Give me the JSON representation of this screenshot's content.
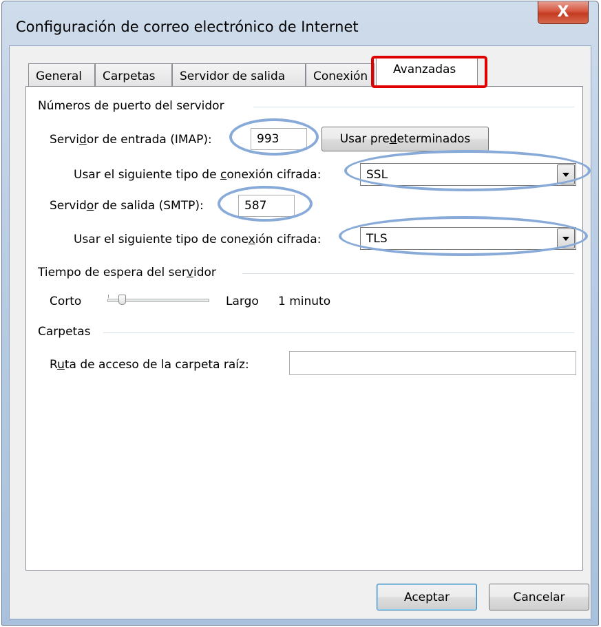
{
  "window": {
    "title": "Configuración de correo electrónico de Internet",
    "close_glyph": "X"
  },
  "tabs": [
    {
      "label": "General",
      "active": false
    },
    {
      "label": "Carpetas",
      "active": false
    },
    {
      "label": "Servidor de salida",
      "active": false
    },
    {
      "label": "Conexión",
      "active": false
    },
    {
      "label": "Avanzadas",
      "active": true
    }
  ],
  "ports": {
    "group_title": "Números de puerto del servidor",
    "incoming": {
      "label_pre": "Servi",
      "label_ul": "d",
      "label_post": "or de entrada (IMAP):",
      "value": "993"
    },
    "defaults_button": {
      "pre": "Usar pre",
      "ul": "d",
      "post": "eterminados"
    },
    "incoming_encryption": {
      "label_pre": "Usar el siguiente tipo de ",
      "label_ul": "c",
      "label_post": "onexión cifrada:",
      "value": "SSL"
    },
    "outgoing": {
      "label_pre": "Servid",
      "label_ul": "o",
      "label_post": "r de salida (SMTP):",
      "value": "587"
    },
    "outgoing_encryption": {
      "label_pre": "Usar el siguiente tipo de cone",
      "label_ul": "x",
      "label_post": "ión cifrada:",
      "value": "TLS"
    }
  },
  "timeout": {
    "group_title_pre": "Tiempo de espera del ser",
    "group_title_ul": "v",
    "group_title_post": "idor",
    "min_label": "Corto",
    "max_label": "Largo",
    "value_text": "1 minuto",
    "level": 0.12
  },
  "folders": {
    "group_title": "Carpetas",
    "root_label_pre": "R",
    "root_label_ul": "u",
    "root_label_post": "ta de acceso de la carpeta raíz:",
    "root_value": ""
  },
  "footer": {
    "ok_label": "Aceptar",
    "cancel_label": "Cancelar"
  },
  "colors": {
    "tab_highlight": "#e00000",
    "annotation_ellipse": "#88aad8"
  }
}
